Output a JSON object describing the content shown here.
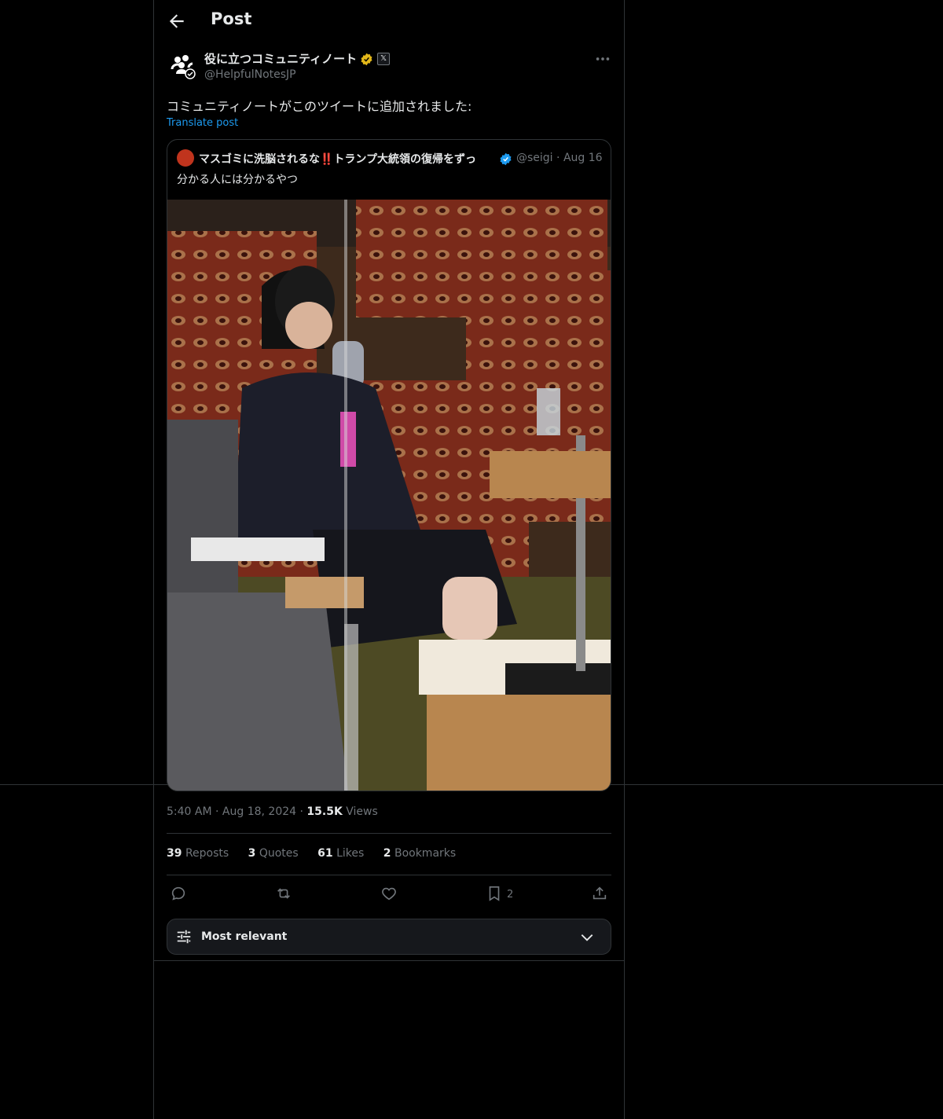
{
  "header": {
    "title": "Post"
  },
  "author": {
    "name": "役に立つコミュニティノート",
    "handle": "@HelpfulNotesJP",
    "affiliate_badge": "𝕏"
  },
  "post": {
    "text": "コミュニティノートがこのツイートに追加されました:",
    "translate_label": "Translate post"
  },
  "quoted": {
    "name": "マスゴミに洗脳されるな‼️トランプ大統領の復帰をずっ",
    "handle": "@seigi",
    "dot": "·",
    "date": "Aug 16",
    "text": "分かる人には分かるやつ"
  },
  "meta": {
    "time": "5:40 AM",
    "dot": "·",
    "date": "Aug 18, 2024",
    "views_count": "15.5K",
    "views_label": "Views"
  },
  "stats": [
    {
      "count": "39",
      "label": "Reposts"
    },
    {
      "count": "3",
      "label": "Quotes"
    },
    {
      "count": "61",
      "label": "Likes"
    },
    {
      "count": "2",
      "label": "Bookmarks"
    }
  ],
  "actions": {
    "bookmark_count": "2"
  },
  "sort": {
    "label": "Most relevant"
  },
  "colors": {
    "accent": "#1d9bf0",
    "gold": "#e2b719",
    "border": "#2f3336",
    "muted": "#71767b"
  }
}
